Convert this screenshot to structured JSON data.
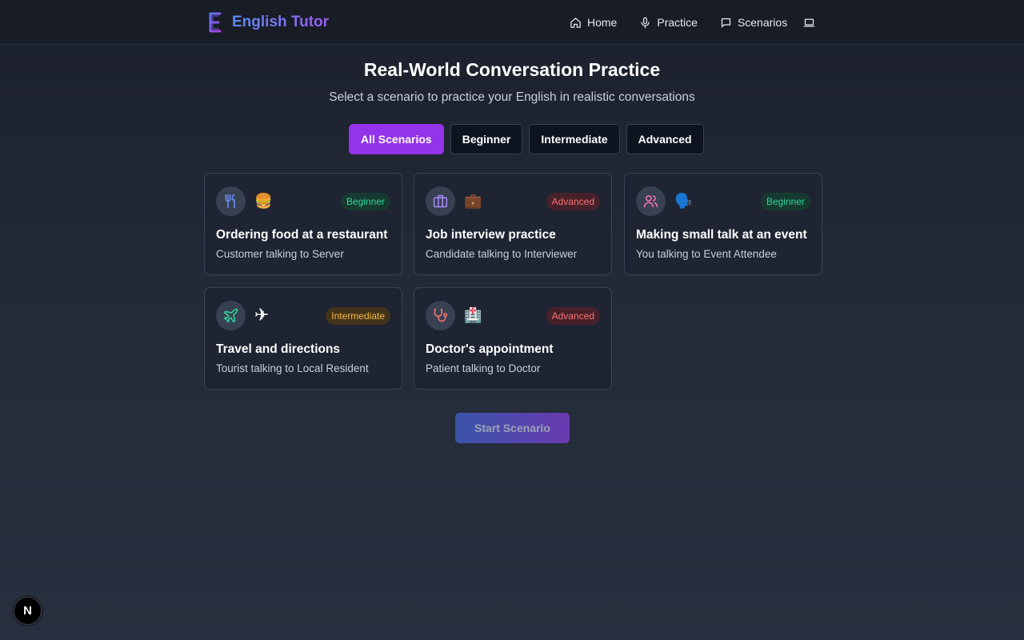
{
  "header": {
    "logo_icon": "english-e-logo-icon",
    "title": "English Tutor",
    "nav": [
      {
        "label": "Home",
        "icon": "home-icon"
      },
      {
        "label": "Practice",
        "icon": "microphone-icon"
      },
      {
        "label": "Scenarios",
        "icon": "chat-bubble-icon"
      }
    ],
    "extra_icon": "laptop-icon"
  },
  "main": {
    "title": "Real-World Conversation Practice",
    "subtitle": "Select a scenario to practice your English in realistic conversations",
    "filters": [
      "All Scenarios",
      "Beginner",
      "Intermediate",
      "Advanced"
    ],
    "active_filter": "All Scenarios",
    "scenarios": [
      {
        "title": "Ordering food at a restaurant",
        "description": "Customer talking to Server",
        "level": "Beginner",
        "icon": "utensils-icon",
        "emoji": "🍔"
      },
      {
        "title": "Job interview practice",
        "description": "Candidate talking to Interviewer",
        "level": "Advanced",
        "icon": "briefcase-icon",
        "emoji": "💼"
      },
      {
        "title": "Making small talk at an event",
        "description": "You talking to Event Attendee",
        "level": "Beginner",
        "icon": "users-icon",
        "emoji": "🗣️"
      },
      {
        "title": "Travel and directions",
        "description": "Tourist talking to Local Resident",
        "level": "Intermediate",
        "icon": "plane-icon",
        "emoji": "✈"
      },
      {
        "title": "Doctor's appointment",
        "description": "Patient talking to Doctor",
        "level": "Advanced",
        "icon": "stethoscope-icon",
        "emoji": "🏥"
      }
    ],
    "start_button": "Start Scenario"
  },
  "dev_badge": "N",
  "colors": {
    "accent": "#9333ea",
    "beginner": "#34d399",
    "intermediate": "#f5b942",
    "advanced": "#f87171"
  }
}
